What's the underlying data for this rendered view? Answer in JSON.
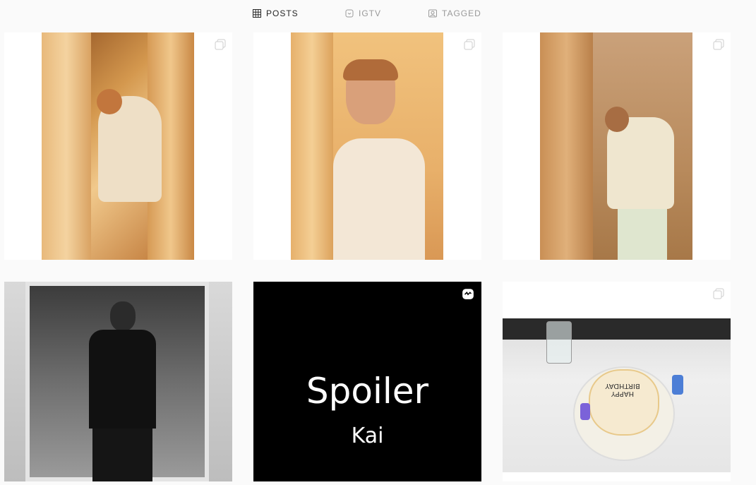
{
  "tabs": [
    {
      "label": "POSTS",
      "icon": "grid-icon",
      "active": true
    },
    {
      "label": "IGTV",
      "icon": "igtv-icon",
      "active": false
    },
    {
      "label": "TAGGED",
      "icon": "tagged-icon",
      "active": false
    }
  ],
  "posts": [
    {
      "kind": "image",
      "badge": "multiple-photos-icon",
      "scene": "person crouching by orange curtain"
    },
    {
      "kind": "image",
      "badge": "multiple-photos-icon",
      "scene": "person behind curtain"
    },
    {
      "kind": "image",
      "badge": "multiple-photos-icon",
      "scene": "person leaning on curtain"
    },
    {
      "kind": "image",
      "badge": "",
      "scene": "black and white mirror selfie"
    },
    {
      "kind": "igtv",
      "badge": "igtv-icon",
      "title": "Spoiler",
      "subtitle": "Kai"
    },
    {
      "kind": "image",
      "badge": "multiple-photos-icon",
      "scene": "birthday cake on table",
      "cake_text": "HAPPY BIRTHDAY"
    }
  ],
  "colors": {
    "active_tab": "#262626",
    "inactive_tab": "#999999",
    "background": "#fafafa"
  }
}
